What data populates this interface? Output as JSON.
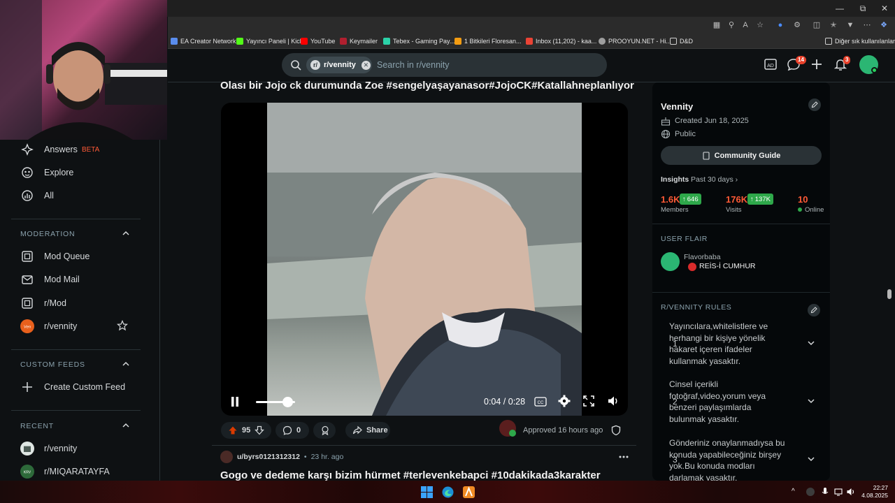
{
  "browser": {
    "bookmarks": [
      {
        "label": "EA Creator Network",
        "color": "#5a8dee"
      },
      {
        "label": "Yayıncı Paneli | Kick",
        "color": "#53fc18"
      },
      {
        "label": "YouTube",
        "color": "#ff0000"
      },
      {
        "label": "Keymailer",
        "color": "#b01f2f"
      },
      {
        "label": "Tebex - Gaming Pay...",
        "color": "#2bd2a8"
      },
      {
        "label": "1 Bitkileri Floresan...",
        "color": "#f39c12"
      },
      {
        "label": "Inbox (11,202) - kaa...",
        "color": "#ea4335"
      },
      {
        "label": "PROOYUN.NET - Hi...",
        "color": "#9e9e9e"
      },
      {
        "label": "D&D",
        "color": "#cfcfcf"
      }
    ],
    "other_bookmarks": "Diğer sık kullanılanlar",
    "window_controls": [
      "minimize-icon",
      "restore-icon",
      "close-icon"
    ]
  },
  "header": {
    "community_chip": "r/vennity",
    "search_placeholder": "Search in r/vennity",
    "chat_badge": "14",
    "notif_badge": "3"
  },
  "sidebar": {
    "top_items": [
      {
        "label": "Answers",
        "badge": "BETA",
        "icon": "answers-icon"
      },
      {
        "label": "Explore",
        "icon": "explore-icon"
      },
      {
        "label": "All",
        "icon": "all-icon"
      }
    ],
    "moderation": {
      "heading": "MODERATION",
      "items": [
        {
          "label": "Mod Queue",
          "icon": "mod-queue-icon"
        },
        {
          "label": "Mod Mail",
          "icon": "mail-icon"
        },
        {
          "label": "r/Mod",
          "icon": "mod-icon"
        },
        {
          "label": "r/vennity",
          "icon": "vennity-avatar"
        }
      ]
    },
    "custom_feeds": {
      "heading": "CUSTOM FEEDS",
      "items": [
        {
          "label": "Create Custom Feed",
          "icon": "plus-icon"
        }
      ]
    },
    "recent": {
      "heading": "RECENT",
      "items": [
        {
          "label": "r/vennity",
          "icon": "vennity-avatar"
        },
        {
          "label": "r/MIQARATAYFA",
          "icon": "miqara-avatar"
        }
      ]
    }
  },
  "post": {
    "title": "Olası bir Jojo ck durumunda Zoe #sengelyaşayanasor#JojoCK#Katallahneplanlıyor",
    "video": {
      "time": "0:04 / 0:28",
      "progress": 0.14
    },
    "votes": "95",
    "comments": "0",
    "share_label": "Share",
    "approved": "Approved 16 hours ago"
  },
  "post2": {
    "user": "u/byrs0121312312",
    "time": "23 hr. ago",
    "title": "Gogo ve dedeme karşı bizim hürmet #terlevenkebapci #10dakikada3karakter"
  },
  "community": {
    "name": "Vennity",
    "created": "Created Jun 18, 2025",
    "visibility": "Public",
    "guide_button": "Community Guide",
    "insights_label": "Insights",
    "insights_period": "Past 30 days",
    "members_value": "1.6K",
    "members_delta": "646",
    "members_label": "Members",
    "visits_value": "176K",
    "visits_delta": "137K",
    "visits_label": "Visits",
    "online_value": "10",
    "online_label": "Online",
    "user_flair_heading": "USER FLAIR",
    "flair_user": "Flavorbaba",
    "flair_text": "REİS-İ CUMHUR",
    "rules_heading": "R/VENNITY RULES",
    "rules": [
      {
        "num": "1",
        "lines": [
          "Yayıncılara,whitelistlere ve",
          "herhangi bir kişiye yönelik",
          "hakaret içeren ifadeler",
          "kullanmak yasaktır."
        ]
      },
      {
        "num": "2",
        "lines": [
          "Cinsel içerikli",
          "fotoğraf,video,yorum veya",
          "benzeri paylaşımlarda",
          "bulunmak yasaktır."
        ]
      },
      {
        "num": "3",
        "lines": [
          "Gönderiniz onaylanmadıysa bu",
          "konuda yapabileceğiniz birşey",
          "yok.Bu konuda modları",
          "darlamak yasaktır."
        ]
      }
    ]
  },
  "taskbar": {
    "time": "22:27",
    "date": "4.08.2025"
  }
}
